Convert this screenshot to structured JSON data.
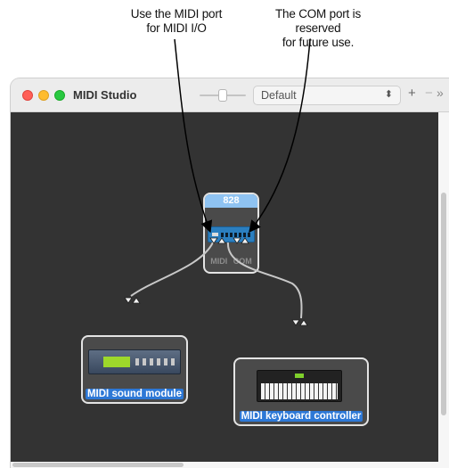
{
  "callouts": {
    "midi_port": {
      "line1": "Use the MIDI port",
      "line2": "for MIDI I/O"
    },
    "com_port": {
      "line1": "The COM port is reserved",
      "line2": "for future use."
    }
  },
  "window": {
    "title": "MIDI Studio",
    "configuration": {
      "selected": "Default"
    },
    "toolbar": {
      "add": "+",
      "remove": "−",
      "more": "»"
    }
  },
  "devices": {
    "interface": {
      "name": "828",
      "ports": [
        "MIDI",
        "COM"
      ]
    },
    "module": {
      "name": "MIDI sound module"
    },
    "keyboard": {
      "name": "MIDI keyboard controller"
    }
  },
  "colors": {
    "canvas": "#333333",
    "device_header": "#8fc3f2",
    "selected_label": "#2d78d6",
    "connection": "#c8c8c8"
  }
}
